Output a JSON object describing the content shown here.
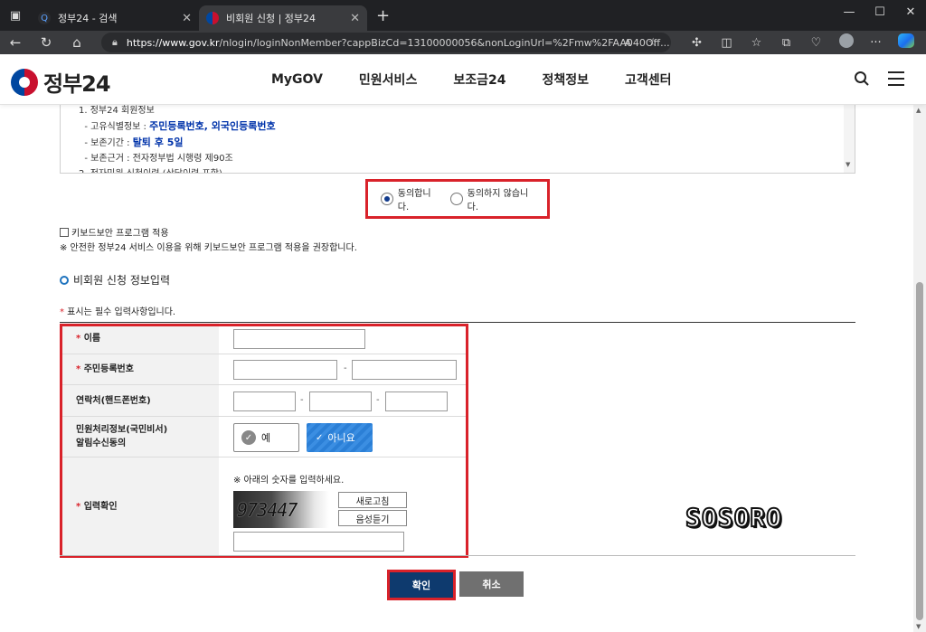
{
  "browser": {
    "tabs": [
      {
        "label": "정부24 - 검색",
        "active": false
      },
      {
        "label": "비회원 신청 | 정부24",
        "active": true
      }
    ],
    "url_host": "https://www.gov.kr",
    "url_path": "/nlogin/loginNonMember?cappBizCd=13100000056&nonLoginUrl=%2Fmw%2FAA040Off...",
    "reader_icon": "read-aloud-icon",
    "copilot_icon": "copilot-icon",
    "colors": {
      "chrome_bg": "#202124",
      "toolbar_bg": "#3a3b3e"
    }
  },
  "header": {
    "logo_text": "정부24",
    "nav": [
      "MyGOV",
      "민원서비스",
      "보조금24",
      "정책정보",
      "고객센터"
    ],
    "search_icon": "search-icon",
    "menu_icon": "hamburger-menu-icon"
  },
  "terms": {
    "line1": "1. 정부24 회원정보",
    "line2_prefix": "- 고유식별정보 : ",
    "line2_value": "주민등록번호, 외국인등록번호",
    "line3_prefix": "- 보존기간 : ",
    "line3_value": "탈퇴 후 5일",
    "line4": "- 보존근거 : 전자정부법 시행령 제90조",
    "line5": "2. 전자민원 신청이력 (상담이력 포함)"
  },
  "consent": {
    "agree_label": "동의합니다.",
    "disagree_label": "동의하지 않습니다.",
    "selected": "agree"
  },
  "keyboard_security": {
    "label": "키보드보안 프로그램 적용",
    "checked": false,
    "note": "※ 안전한 정부24 서비스 이용을 위해 키보드보안 프로그램 적용을 권장합니다."
  },
  "section": {
    "title": "비회원 신청 정보입력",
    "required_star": "*",
    "required_note": " 표시는 필수 입력사항입니다."
  },
  "form": {
    "name_label": "이름",
    "rrn_label": "주민등록번호",
    "phone_label": "연락처(핸드폰번호)",
    "notify_label_line1": "민원처리정보(국민비서)",
    "notify_label_line2": "알림수신동의",
    "notify_yes": "예",
    "notify_no": "아니요",
    "notify_selected": "아니요",
    "captcha_label": "입력확인",
    "captcha_note": "※ 아래의 숫자를 입력하세요.",
    "captcha_value": "973447",
    "refresh_label": "새로고침",
    "audio_label": "음성듣기",
    "dash": "-"
  },
  "buttons": {
    "confirm": "확인",
    "cancel": "취소"
  },
  "watermark": "SOSORO",
  "highlight_color": "#d9222a",
  "accent_color": "#0e3a6e"
}
